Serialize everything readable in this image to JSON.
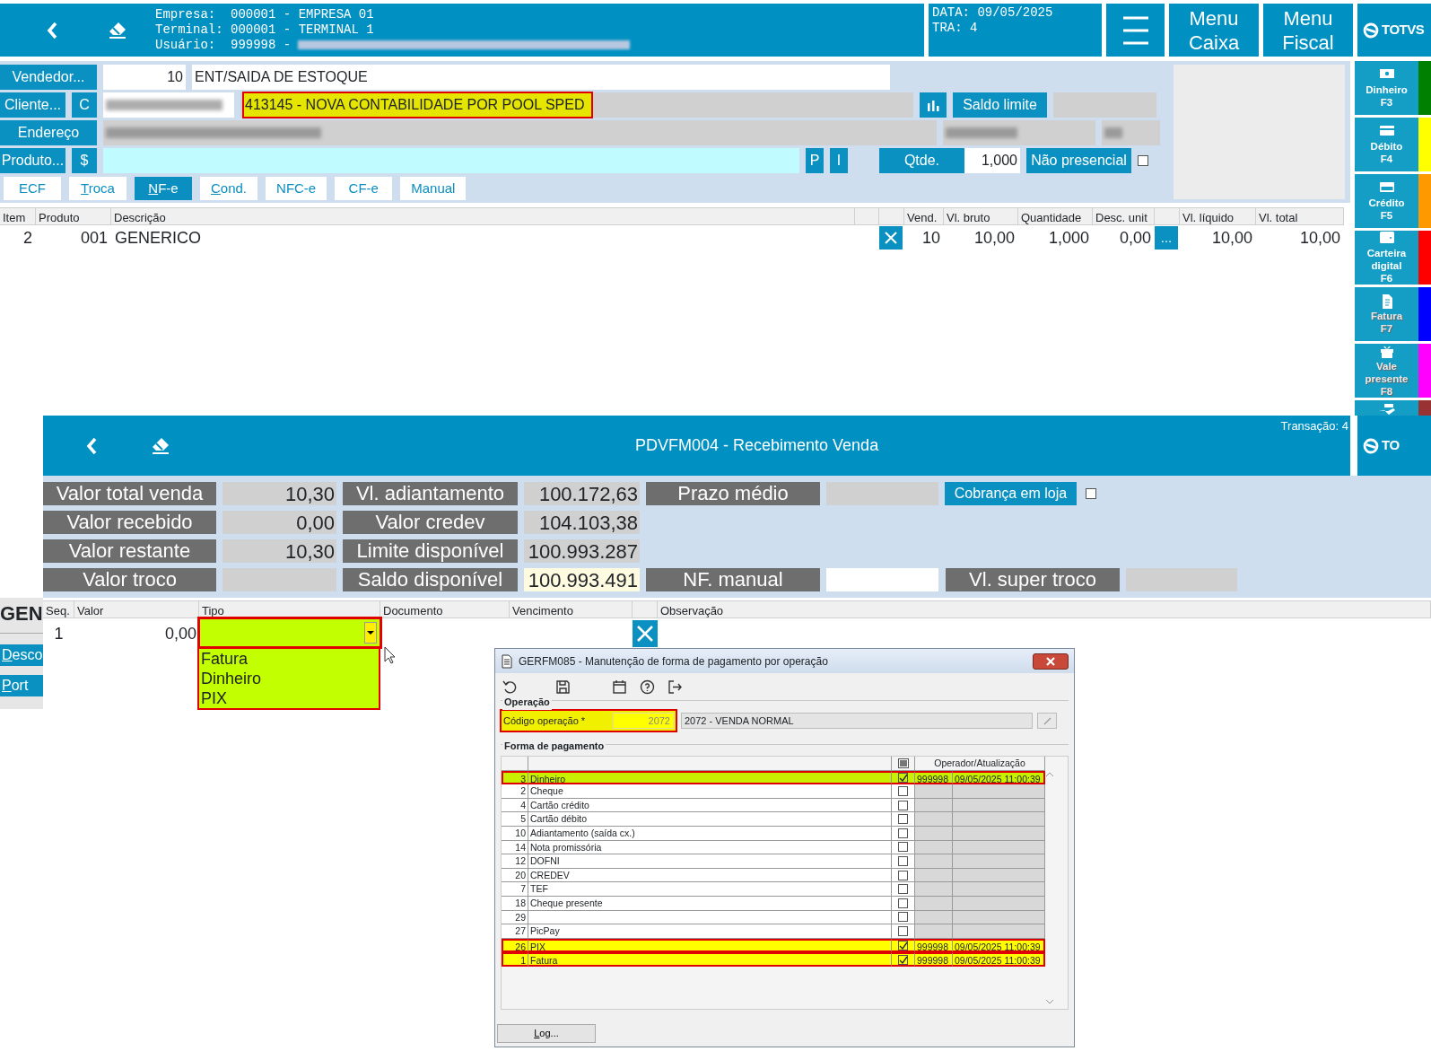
{
  "main_window": {
    "header": {
      "info_lines": [
        "Empresa:  000001 - EMPRESA 01",
        "Terminal: 000001 - TERMINAL 1",
        "Usuário:  999998 -"
      ],
      "date_lines": [
        "DATA: 09/05/2025",
        "TRA: 4"
      ],
      "menu_buttons": [
        "Menu\nCaixa",
        "Menu\nFiscal"
      ],
      "logo": "TOTVS"
    },
    "vendedor": {
      "label": "Vendedor...",
      "code": "10",
      "name": "ENT/SAIDA DE ESTOQUE"
    },
    "cliente": {
      "label": "Cliente...",
      "type_button": "C",
      "name": "413145 - NOVA CONTABILIDADE POR POOL SPED",
      "highlighted": true,
      "annotated": true,
      "saldo_button": "Saldo limite"
    },
    "endereco": {
      "label": "Endereço"
    },
    "produto": {
      "label": "Produto...",
      "price_button": "$",
      "buttons": [
        "P",
        "I"
      ],
      "qty_button": "Qtde.",
      "qty": "1,000",
      "nao_presencial": {
        "label": "Não presencial",
        "checked": false
      }
    },
    "doc_tabs": [
      {
        "label": "ECF",
        "mnemonic": false,
        "selected": false
      },
      {
        "label": "Troca",
        "mnemonic": true,
        "selected": false
      },
      {
        "label": "NF-e",
        "mnemonic": true,
        "selected": true
      },
      {
        "label": "Cond.",
        "mnemonic": true,
        "selected": false
      },
      {
        "label": "NFC-e",
        "mnemonic": false,
        "selected": false
      },
      {
        "label": "CF-e",
        "mnemonic": false,
        "selected": false
      },
      {
        "label": "Manual",
        "mnemonic": false,
        "selected": false
      }
    ],
    "items_table": {
      "columns": [
        "Item",
        "Produto",
        "Descrição",
        "Vend.",
        "Vl. bruto",
        "Quantidade",
        "Desc. unit",
        "Vl. líquido",
        "Vl. total"
      ],
      "rows": [
        {
          "item": "2",
          "product": "001",
          "description": "GENERICO",
          "seller": "10",
          "gross": "10,00",
          "quantity": "1,000",
          "unit_discount": "0,00",
          "more_button": "...",
          "net": "10,00",
          "total": "10,00"
        }
      ]
    },
    "payment_buttons": [
      {
        "label": "Dinheiro",
        "key": "F3",
        "color": "#008000",
        "disabled": false
      },
      {
        "label": "Débito",
        "key": "F4",
        "color": "#ffff00",
        "disabled": false
      },
      {
        "label": "Crédito",
        "key": "F5",
        "color": "#ff9900",
        "disabled": false
      },
      {
        "label": "Carteira digital",
        "key": "F6",
        "color": "#ff0000",
        "disabled": false
      },
      {
        "label": "Fatura",
        "key": "F7",
        "color": "#0000ff",
        "disabled": true
      },
      {
        "label": "Vale presente",
        "key": "F8",
        "color": "#ff00ff",
        "disabled": true
      },
      {
        "color": "#993333"
      }
    ],
    "side_fragments": [
      {
        "label": "GEN",
        "kind": "text",
        "mnemonic": false
      },
      {
        "label": "Desco",
        "kind": "button",
        "mnemonic": true
      },
      {
        "label": "Port",
        "kind": "button",
        "mnemonic": true
      }
    ]
  },
  "receipt_window": {
    "title": "PDVFM004 - Recebimento Venda",
    "transaction": "Transação: 4",
    "logo": "TO",
    "summary": [
      {
        "label": "Valor total venda",
        "value": "10,30"
      },
      {
        "label": "Vl. adiantamento",
        "value": "100.172,63"
      },
      {
        "label": "Prazo médio",
        "button": "Cobrança em loja",
        "checked": false
      },
      {
        "label": "Valor recebido",
        "value": "0,00"
      },
      {
        "label": "Valor credev",
        "value": "104.103,38"
      },
      {
        "kind": "empty"
      },
      {
        "label": "Valor restante",
        "value": "10,30"
      },
      {
        "label": "Limite disponível",
        "value": "100.993.287"
      },
      {
        "kind": "empty"
      },
      {
        "label": "Valor troco"
      },
      {
        "label": "Saldo disponível",
        "value": "100.993.491",
        "highlighted": true
      },
      {
        "label": "NF. manual",
        "value_white": true,
        "label2": "Vl. super troco"
      }
    ],
    "payments_table": {
      "columns": [
        "Seq.",
        "Valor",
        "Tipo",
        "Documento",
        "Vencimento",
        "Observação"
      ],
      "rows": [
        {
          "seq": "1",
          "value": "0,00",
          "type_annotated": true,
          "type_options": [
            "Fatura",
            "Dinheiro",
            "PIX"
          ]
        }
      ]
    }
  },
  "dialog": {
    "title": "GERFM085 - Manutenção de forma de pagamento por operação",
    "operacao": {
      "legend": "Operação",
      "label": "Código operação *",
      "code": "2072",
      "description": "2072 - VENDA NORMAL",
      "annotated": true
    },
    "forma_pagamento": {
      "legend": "Forma de pagamento",
      "header": "Operador/Atualização",
      "select_all_partial": true,
      "rows": [
        {
          "code": "3",
          "name": "Dinheiro",
          "checked": true,
          "operator": "999998",
          "updated": "09/05/2025 11:00:39",
          "color": "#c8f000",
          "annotated": true
        },
        {
          "code": "2",
          "name": "Cheque",
          "checked": false
        },
        {
          "code": "4",
          "name": "Cartão crédito",
          "checked": false
        },
        {
          "code": "5",
          "name": "Cartão débito",
          "checked": false
        },
        {
          "code": "10",
          "name": "Adiantamento (saída cx.)",
          "checked": false
        },
        {
          "code": "14",
          "name": "Nota promissória",
          "checked": false
        },
        {
          "code": "12",
          "name": "DOFNI",
          "checked": false
        },
        {
          "code": "20",
          "name": "CREDEV",
          "checked": false
        },
        {
          "code": "7",
          "name": "TEF",
          "checked": false
        },
        {
          "code": "18",
          "name": "Cheque presente",
          "checked": false
        },
        {
          "code": "29",
          "checked": false
        },
        {
          "code": "27",
          "name": "PicPay",
          "checked": false
        },
        {
          "code": "26",
          "name": "PIX",
          "checked": true,
          "operator": "999998",
          "updated": "09/05/2025 11:00:39",
          "color": "#ffff00",
          "annotated": true
        },
        {
          "code": "1",
          "name": "Fatura",
          "checked": true,
          "operator": "999998",
          "updated": "09/05/2025 11:00:39",
          "color": "#ffff00",
          "annotated": true
        }
      ]
    },
    "log_button": "Log..."
  }
}
